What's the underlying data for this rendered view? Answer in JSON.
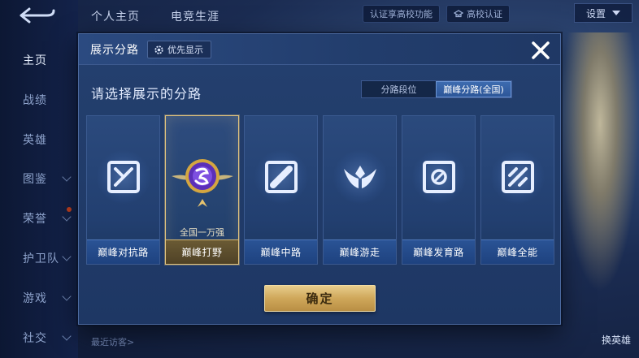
{
  "top_tabs": [
    "个人主页",
    "电竞生涯"
  ],
  "top_bar": {
    "verify_text": "认证享高校功能",
    "campus_label": "高校认证",
    "settings_label": "设置"
  },
  "sidebar": {
    "items": [
      {
        "label": "主页",
        "active": true,
        "chevron": false
      },
      {
        "label": "战绩",
        "active": false,
        "chevron": false
      },
      {
        "label": "英雄",
        "active": false,
        "chevron": false
      },
      {
        "label": "图鉴",
        "active": false,
        "chevron": true
      },
      {
        "label": "荣誉",
        "active": false,
        "chevron": true
      },
      {
        "label": "护卫队",
        "active": false,
        "chevron": true
      },
      {
        "label": "游戏",
        "active": false,
        "chevron": true
      },
      {
        "label": "社交",
        "active": false,
        "chevron": true
      }
    ]
  },
  "bottom": {
    "recent_visitors": "最近访客>",
    "switch_hero": "换英雄"
  },
  "modal": {
    "title": "展示分路",
    "priority_label": "优先显示",
    "section_title": "请选择展示的分路",
    "toggle": {
      "options": [
        "分路段位",
        "巅峰分路(全国)"
      ],
      "selected_index": 1
    },
    "lanes": [
      {
        "label": "巅峰对抗路",
        "icon": "clash-lane-icon",
        "selected": false
      },
      {
        "label": "巅峰打野",
        "icon": "jungle-rank-badge",
        "selected": true,
        "rank_text": "全国一万强"
      },
      {
        "label": "巅峰中路",
        "icon": "mid-lane-icon",
        "selected": false
      },
      {
        "label": "巅峰游走",
        "icon": "roam-icon",
        "selected": false
      },
      {
        "label": "巅峰发育路",
        "icon": "farm-lane-icon",
        "selected": false
      },
      {
        "label": "巅峰全能",
        "icon": "all-round-icon",
        "selected": false
      }
    ],
    "confirm_label": "确定"
  },
  "colors": {
    "modal_bg": "#24406f",
    "selected_border": "#e2c47e",
    "confirm_gold": "#cfa75a",
    "toggle_active": "#3d6bb0"
  }
}
